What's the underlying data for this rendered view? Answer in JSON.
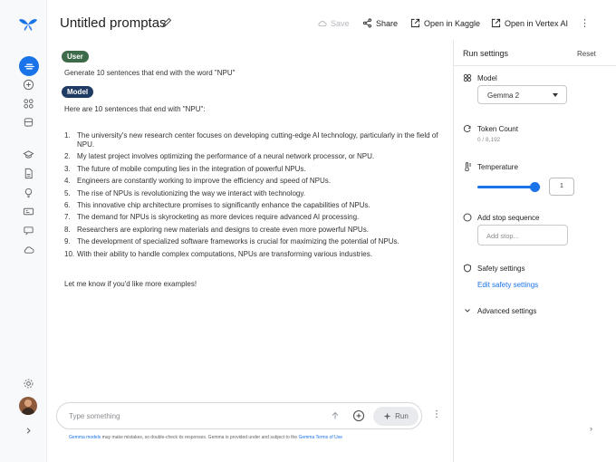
{
  "header": {
    "title": "Untitled promptas",
    "save_label": "Save",
    "share_label": "Share",
    "kaggle_label": "Open in Kaggle",
    "vertex_label": "Open in Vertex AI"
  },
  "chat": {
    "user_role": "User",
    "user_message": "Generate 10 sentences that end with the word \"NPU\"",
    "model_role": "Model",
    "model_intro": "Here are 10 sentences that end with \"NPU\":",
    "items": [
      {
        "num": "1.",
        "text": "The university's new research center focuses on developing cutting-edge AI technology, particularly in the field of NPU."
      },
      {
        "num": "2.",
        "text": "My latest project involves optimizing the performance of a neural network processor, or NPU."
      },
      {
        "num": "3.",
        "text": "The future of mobile computing lies in the integration of powerful NPUs."
      },
      {
        "num": "4.",
        "text": "Engineers are constantly working to improve the efficiency and speed of NPUs."
      },
      {
        "num": "5.",
        "text": "The rise of NPUs is revolutionizing the way we interact with technology."
      },
      {
        "num": "6.",
        "text": "This innovative chip architecture promises to significantly enhance the capabilities of NPUs."
      },
      {
        "num": "7.",
        "text": "The demand for NPUs is skyrocketing as more devices require advanced AI processing."
      },
      {
        "num": "8.",
        "text": "Researchers are exploring new materials and designs to create even more powerful NPUs."
      },
      {
        "num": "9.",
        "text": "The development of specialized software frameworks is crucial for maximizing the potential of NPUs."
      },
      {
        "num": "10.",
        "text": "With their ability to handle complex computations, NPUs are transforming various industries."
      }
    ],
    "closing": "Let me know if you'd like more examples!"
  },
  "prompt": {
    "placeholder": "Type something",
    "run_label": "Run",
    "disclaimer_link1": "Gemma models",
    "disclaimer_text": " may make mistakes, so double-check its responses. Gemma is provided under and subject to the ",
    "disclaimer_link2": "Gemma Terms of Use"
  },
  "settings": {
    "title": "Run settings",
    "reset_label": "Reset",
    "model_label": "Model",
    "model_value": "Gemma 2",
    "token_label": "Token Count",
    "token_value": "0 / 8,192",
    "temperature_label": "Temperature",
    "temperature_value": "1",
    "temperature_fraction": 0.9,
    "stop_label": "Add stop sequence",
    "stop_placeholder": "Add stop...",
    "safety_label": "Safety settings",
    "safety_link": "Edit safety settings",
    "advanced_label": "Advanced settings"
  },
  "colors": {
    "accent": "#1a73e8",
    "user_chip": "#3d6b4a",
    "model_chip": "#1f3a63"
  },
  "icons": [
    "gemma-logo-icon",
    "chat-prompt-icon",
    "add-icon",
    "apps-icon",
    "library-icon",
    "school-icon",
    "docs-icon",
    "lightbulb-icon",
    "gallery-icon",
    "forum-icon",
    "cloud-icon",
    "settings-icon",
    "chevron-right-icon"
  ]
}
